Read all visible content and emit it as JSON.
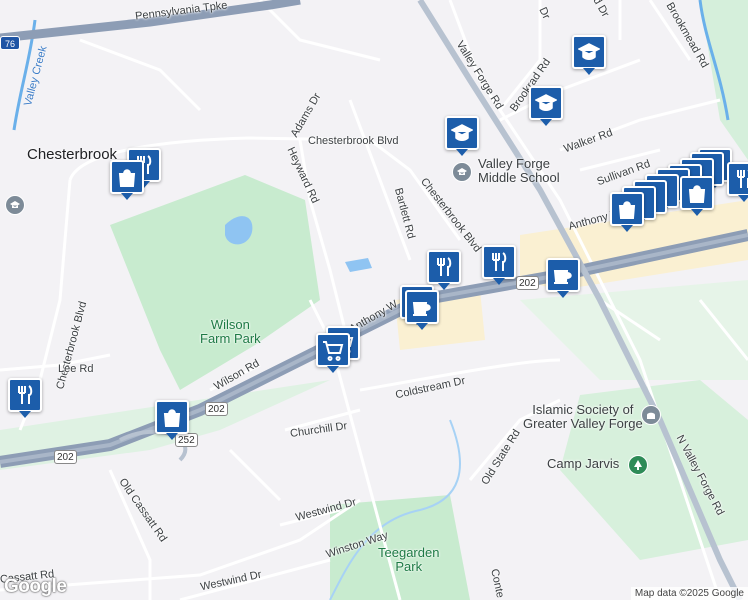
{
  "colors": {
    "background": "#f3f2f5",
    "park": "#c8ebcf",
    "water": "#8fc4f2",
    "highway": "#8d9db5",
    "road": "#ffffff",
    "commercial": "#faf0d2",
    "marker": "#1c5daa"
  },
  "highways": {
    "turnpike": "Pennsylvania Tpke",
    "i76_shield": "76",
    "us202_shield_1": "202",
    "us202_shield_2": "202",
    "us202_shield_3": "202",
    "route252_shield": "252"
  },
  "place_labels": {
    "chesterbrook": "Chesterbrook"
  },
  "parks": {
    "wilson_farm": "Wilson\nFarm Park",
    "teegarden": "Teegarden\nPark"
  },
  "pois": {
    "valley_forge_ms": "Valley Forge\nMiddle School",
    "islamic_society": "Islamic Society of\nGreater Valley Forge",
    "camp_jarvis": "Camp Jarvis"
  },
  "water_labels": {
    "valley_creek": "Valley Creek"
  },
  "roads": {
    "pennsylvania_tpke": "Pennsylvania Tpke",
    "valley_forge_rd": "Valley Forge Rd",
    "brookrad_rd": "Brookrad Rd",
    "brookmead_rd": "Brookmead Rd",
    "walker_rd": "Walker Rd",
    "sullivan_rd": "Sullivan Rd",
    "anthony_wayne": "Anthony W",
    "adams_dr": "Adams Dr",
    "chesterbrook_blvd_n": "Chesterbrook Blvd",
    "chesterbrook_blvd_e": "Chesterbrook Blvd",
    "chesterbrook_blvd_w": "Chesterbrook Blvd",
    "heyward_rd": "Heyward Rd",
    "bartlett_rd": "Bartlett Rd",
    "w_anthony_wayne": "W Anthony W",
    "lee_rd": "Lee Rd",
    "wilson_rd": "Wilson Rd",
    "coldstream_dr": "Coldstream Dr",
    "churchill_dr": "Churchill Dr",
    "old_state_rd": "Old State Rd",
    "n_valley_forge_rd": "N Valley Forge Rd",
    "old_cassatt_rd": "Old Cassatt Rd",
    "westwind_dr_1": "Westwind Dr",
    "winston_way": "Winston Way",
    "cassatt_rd": "Cassatt Rd",
    "westwind_dr_2": "Westwind Dr",
    "conte": "Conte",
    "dr_top": "Dr",
    "top_right": "d Dr"
  },
  "markers": [
    {
      "type": "shopping"
    },
    {
      "type": "restaurant"
    },
    {
      "type": "restaurant"
    },
    {
      "type": "shopping"
    },
    {
      "type": "grocery"
    },
    {
      "type": "grocery"
    },
    {
      "type": "restaurant"
    },
    {
      "type": "restaurant"
    },
    {
      "type": "cafe"
    },
    {
      "type": "cafe"
    },
    {
      "type": "cafe"
    },
    {
      "type": "school"
    },
    {
      "type": "school"
    },
    {
      "type": "school"
    },
    {
      "type": "shopping"
    },
    {
      "type": "shopping"
    },
    {
      "type": "restaurant"
    }
  ],
  "attribution": "Map data ©2025 Google",
  "logo": "Google"
}
